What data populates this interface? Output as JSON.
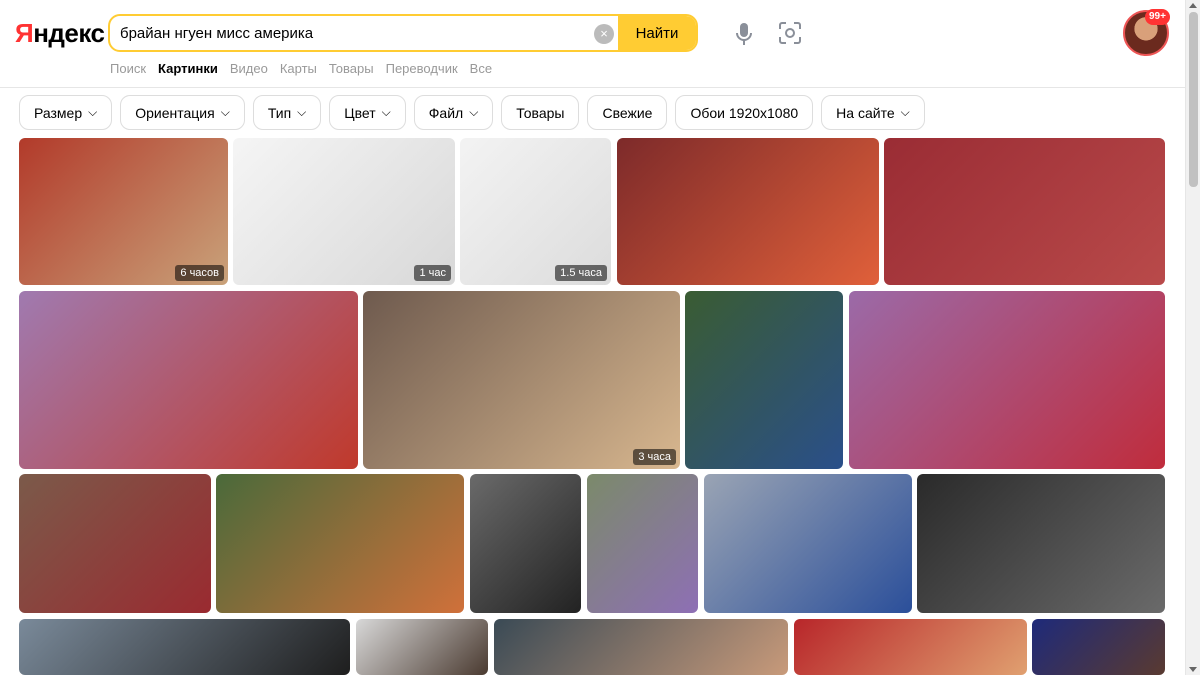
{
  "logo": {
    "first_letter": "Я",
    "rest": "ндекс"
  },
  "search": {
    "query": "брайан нгуен мисс америка",
    "clear_label": "×",
    "submit_label": "Найти"
  },
  "badge": "99+",
  "nav": [
    {
      "label": "Поиск",
      "active": false
    },
    {
      "label": "Картинки",
      "active": true
    },
    {
      "label": "Видео",
      "active": false
    },
    {
      "label": "Карты",
      "active": false
    },
    {
      "label": "Товары",
      "active": false
    },
    {
      "label": "Переводчик",
      "active": false
    },
    {
      "label": "Все",
      "active": false
    }
  ],
  "filters": [
    {
      "label": "Размер",
      "dropdown": true
    },
    {
      "label": "Ориентация",
      "dropdown": true
    },
    {
      "label": "Тип",
      "dropdown": true
    },
    {
      "label": "Цвет",
      "dropdown": true
    },
    {
      "label": "Файл",
      "dropdown": true
    },
    {
      "label": "Товары",
      "dropdown": false
    },
    {
      "label": "Свежие",
      "dropdown": false
    },
    {
      "label": "Обои 1920x1080",
      "dropdown": false
    },
    {
      "label": "На сайте",
      "dropdown": true
    }
  ],
  "images": [
    {
      "name": "pageant-red-dress-and-blonde-collage",
      "time": "6 часов",
      "colors": [
        "#b23a2a",
        "#c9a27a"
      ]
    },
    {
      "name": "tweet-screenshot",
      "time": "1 час",
      "colors": [
        "#f5f5f5",
        "#d8d8d8"
      ]
    },
    {
      "name": "tweet-screenshot-2",
      "time": "1.5 часа",
      "colors": [
        "#f3f3f3",
        "#dcdcdc"
      ]
    },
    {
      "name": "group-photo-and-orange-dress",
      "time": "",
      "colors": [
        "#7d2a2a",
        "#e0603a"
      ]
    },
    {
      "name": "pageant-group-collage",
      "time": "",
      "colors": [
        "#9a2c34",
        "#b94a4a"
      ]
    },
    {
      "name": "red-dress-crown-bouquet",
      "time": "",
      "colors": [
        "#a07ab0",
        "#c0392b"
      ]
    },
    {
      "name": "blonde-woman-portrait",
      "time": "3 часа",
      "colors": [
        "#6e5a4e",
        "#d8b78f"
      ]
    },
    {
      "name": "denim-jacket-portrait",
      "time": "",
      "colors": [
        "#3a5c32",
        "#2a4f8a"
      ]
    },
    {
      "name": "pageant-stage-sequence",
      "time": "",
      "colors": [
        "#9b6aa8",
        "#c02c3c"
      ]
    },
    {
      "name": "contestants-group",
      "time": "",
      "colors": [
        "#7b5a4a",
        "#9a2a30"
      ]
    },
    {
      "name": "orange-dress-tropical",
      "time": "",
      "colors": [
        "#4a6a3a",
        "#d0703a"
      ]
    },
    {
      "name": "black-lace-portrait",
      "time": "",
      "colors": [
        "#6a6a6a",
        "#222222"
      ]
    },
    {
      "name": "sash-crown-portrait",
      "time": "",
      "colors": [
        "#7b8a6a",
        "#8e6fb5"
      ]
    },
    {
      "name": "blue-gown-winner",
      "time": "",
      "colors": [
        "#9aa4b4",
        "#2b4f9a"
      ]
    },
    {
      "name": "sequin-dress-sash",
      "time": "",
      "colors": [
        "#2a2a2a",
        "#6a6a6a"
      ]
    },
    {
      "name": "street-costumes",
      "time": "",
      "colors": [
        "#7a8a9a",
        "#1e1e1e"
      ]
    },
    {
      "name": "crown-portrait",
      "time": "",
      "colors": [
        "#d8d8d8",
        "#4a3a30"
      ]
    },
    {
      "name": "man-portrait",
      "time": "",
      "colors": [
        "#3a4a55",
        "#c89a7a"
      ]
    },
    {
      "name": "red-backdrop-crown",
      "time": "",
      "colors": [
        "#b8262a",
        "#e0a070"
      ]
    },
    {
      "name": "blue-backdrop-crown",
      "time": "",
      "colors": [
        "#1e2a7a",
        "#5a3a30"
      ]
    }
  ]
}
